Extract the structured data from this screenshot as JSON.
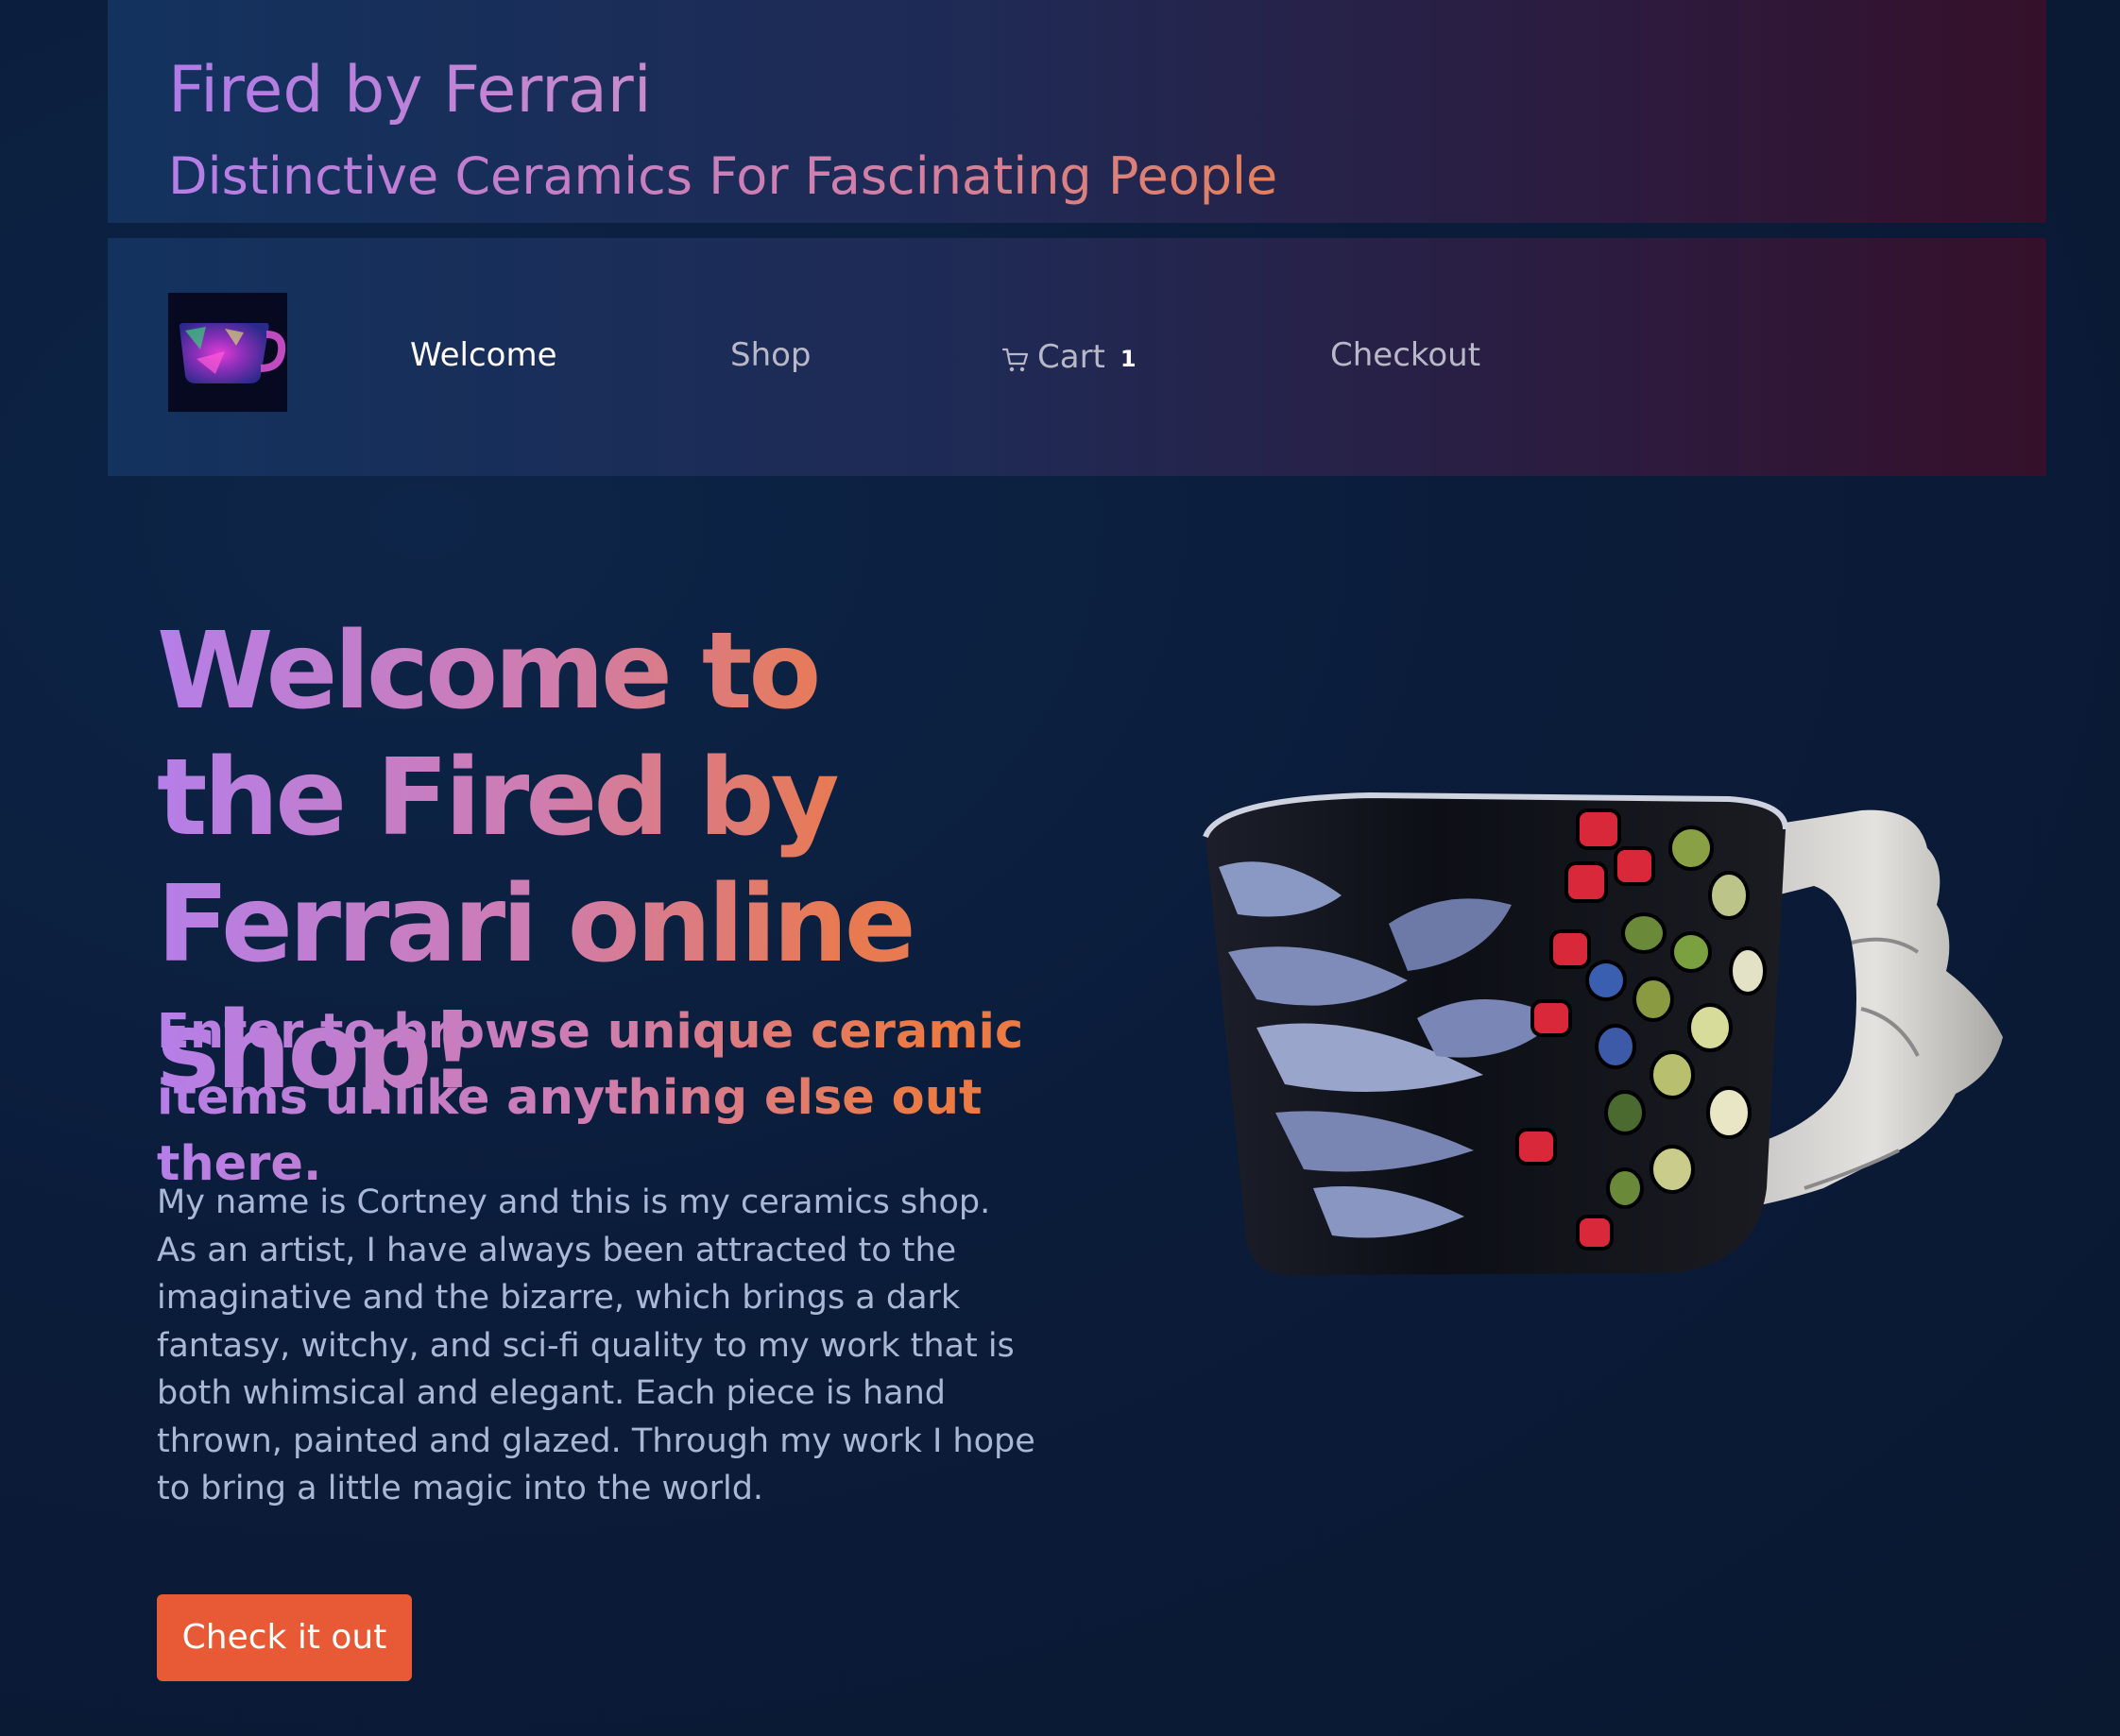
{
  "header": {
    "title": "Fired by Ferrari",
    "tagline": "Distinctive Ceramics For Fascinating People"
  },
  "nav": {
    "logo_icon": "mug-logo-icon",
    "items": [
      {
        "label": "Welcome",
        "active": true
      },
      {
        "label": "Shop",
        "active": false
      },
      {
        "label": "Cart",
        "active": false
      },
      {
        "label": "Checkout",
        "active": false
      }
    ],
    "cart_icon": "cart-icon",
    "cart_count": "1"
  },
  "hero": {
    "heading": "Welcome to the Fired by Ferrari online shop!",
    "subheading": "Enter to browse unique ceramic items unlike anything else out there.",
    "body": "My name is Cortney and this is my ceramics shop. As an artist, I have always been attracted to the imaginative and the bizarre, which brings a dark fantasy, witchy, and sci-fi quality to my work that is both whimsical and elegant. Each piece is hand thrown, painted and glazed. Through my work I hope to bring a little magic into the world.",
    "cta_label": "Check it out",
    "image_icon": "ceramic-mug-image"
  },
  "colors": {
    "accent": "#e85a35",
    "gradient_start": "#b57ee8",
    "gradient_end": "#e87a52",
    "background": "#0b1c3a"
  }
}
